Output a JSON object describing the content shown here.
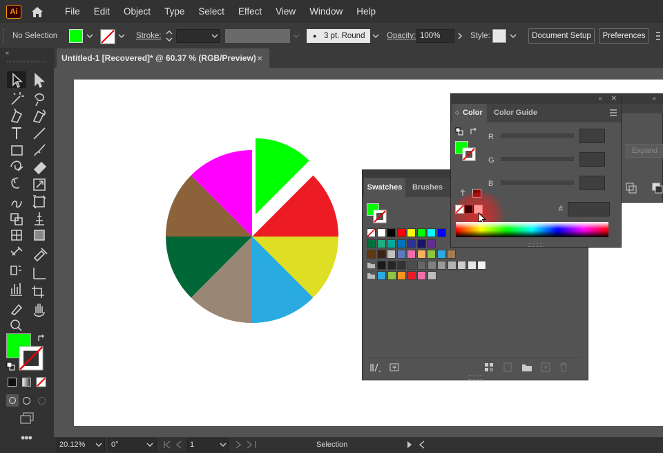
{
  "app": {
    "logo": "Ai",
    "home_icon": "home-icon"
  },
  "menu": [
    "File",
    "Edit",
    "Object",
    "Type",
    "Select",
    "Effect",
    "View",
    "Window",
    "Help"
  ],
  "control_bar": {
    "selection": "No Selection",
    "stroke_label": "Stroke:",
    "brush": "3 pt. Round",
    "opacity_label": "Opacity:",
    "opacity_value": "100%",
    "style_label": "Style:",
    "document_setup": "Document Setup",
    "preferences": "Preferences",
    "fill_color": "#00ff00"
  },
  "document_tab": {
    "title": "Untitled-1 [Recovered]* @ 60.37 % (RGB/Preview)",
    "close": "×"
  },
  "status_bar": {
    "zoom": "20.12%",
    "rotation": "0°",
    "artboard": "1",
    "mode": "Selection"
  },
  "color_panel": {
    "tabs": [
      "Color",
      "Color Guide"
    ],
    "channels": [
      "R",
      "G",
      "B"
    ],
    "hex_label": "#",
    "expand": "Expand",
    "collapse_icon": "«",
    "close_icon": "×"
  },
  "swatches_panel": {
    "tabs": [
      "Swatches",
      "Brushes"
    ],
    "rows": [
      [
        "none",
        "#ffffff",
        "#000000",
        "#ff0000",
        "#ffff00",
        "#00ff00",
        "#00ffff",
        "#0000ff"
      ],
      [
        "#00703c",
        "#1aaf7f",
        "#00a99d",
        "#0072bc",
        "#2e3192",
        "#1b1464",
        "#662d91"
      ],
      [
        "#603913",
        "#3b2314",
        "#c0c0c0",
        "#5b7bc0",
        "#f06eaa",
        "#fbaf5d",
        "#8dc63f",
        "#29abe2",
        "#a67c52"
      ],
      [
        "#1a1a1a",
        "#262626",
        "#333333",
        "#4d4d4d",
        "#666666",
        "#808080",
        "#999999",
        "#b3b3b3",
        "#cccccc",
        "#e6e6e6",
        "#f2f2f2"
      ],
      [
        "#29abe2",
        "#8dc63f",
        "#f7941d",
        "#ed1c24",
        "#f06eaa",
        "#bcbec0"
      ]
    ]
  },
  "pie_chart": {
    "slices": [
      {
        "name": "green",
        "color": "#00ff00"
      },
      {
        "name": "red",
        "color": "#ed1c24"
      },
      {
        "name": "yellow",
        "color": "#dede24"
      },
      {
        "name": "blue",
        "color": "#29abe2"
      },
      {
        "name": "tan",
        "color": "#998675"
      },
      {
        "name": "dark-green",
        "color": "#006837"
      },
      {
        "name": "brown",
        "color": "#8b6239"
      },
      {
        "name": "magenta",
        "color": "#ff00ff"
      }
    ]
  }
}
